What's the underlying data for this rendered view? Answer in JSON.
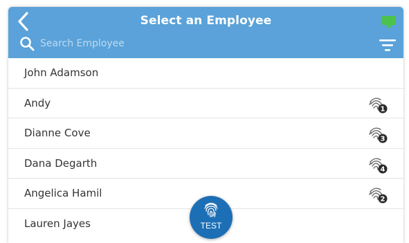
{
  "header": {
    "title": "Select an Employee",
    "back_icon": "chevron-left-icon",
    "status_icon": "monitor-icon",
    "status_color": "#4cc24c",
    "accent": "#5aa2d9"
  },
  "search": {
    "placeholder": "Search Employee",
    "value": "",
    "icon": "search-icon",
    "filter_icon": "filter-icon"
  },
  "employees": [
    {
      "name": "John Adamson",
      "fingerprint": null
    },
    {
      "name": "Andy",
      "fingerprint": "1"
    },
    {
      "name": "Dianne Cove",
      "fingerprint": "3"
    },
    {
      "name": "Dana Degarth",
      "fingerprint": "4"
    },
    {
      "name": "Angelica Hamil",
      "fingerprint": "2"
    },
    {
      "name": "Lauren Jayes",
      "fingerprint": null
    }
  ],
  "fab": {
    "label": "TEST",
    "icon": "fingerprint-icon",
    "color": "#1d6fb5"
  }
}
